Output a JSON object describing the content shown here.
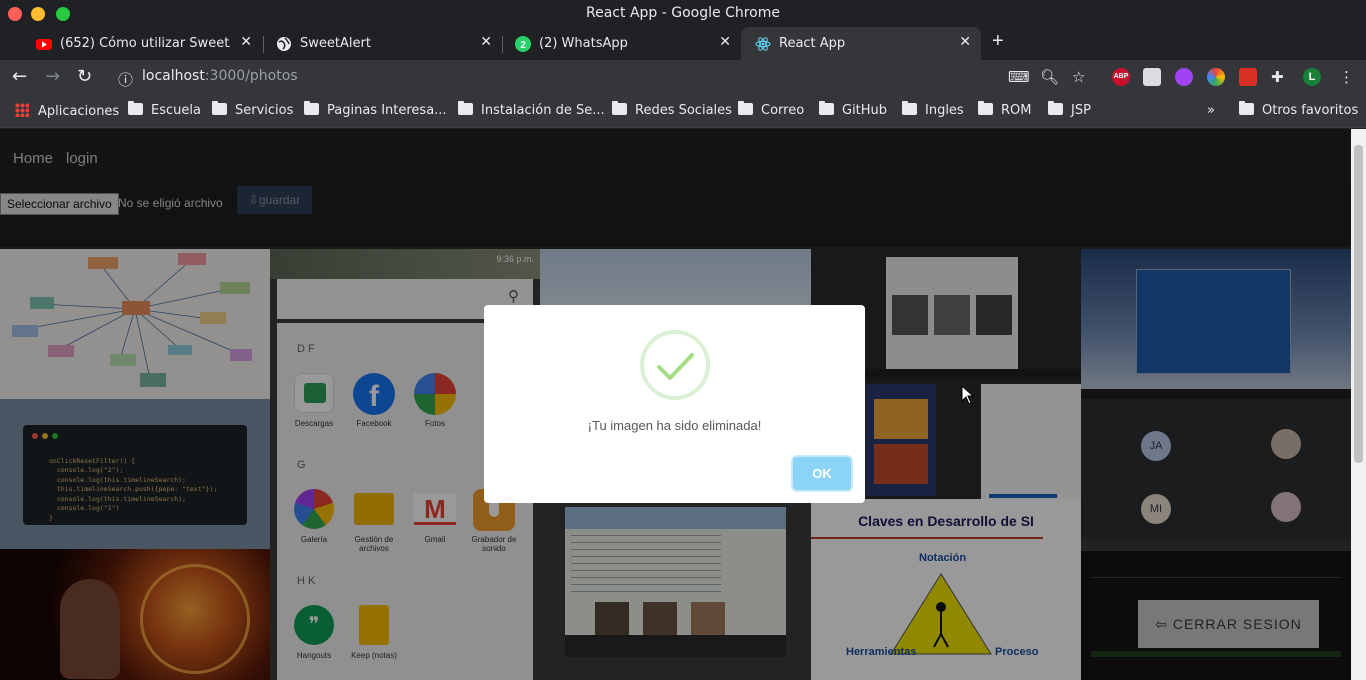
{
  "window": {
    "title": "React App - Google Chrome"
  },
  "tabs": [
    {
      "label": "(652) Cómo utilizar SweetAlert",
      "icon": "youtube-icon"
    },
    {
      "label": "SweetAlert",
      "icon": "globe-icon"
    },
    {
      "label": "(2) WhatsApp",
      "icon": "whatsapp-icon",
      "badge": "2"
    },
    {
      "label": "React App",
      "icon": "react-icon"
    }
  ],
  "toolbar": {
    "url_host": "localhost",
    "url_path": ":3000/photos",
    "profile_initial": "L",
    "abp_label": "ABP"
  },
  "bookmarks": {
    "apps": "Aplicaciones",
    "items": [
      "Escuela",
      "Servicios",
      "Paginas Interesa...",
      "Instalación de Se...",
      "Redes Sociales",
      "Correo",
      "GitHub",
      "Ingles",
      "ROM",
      "JSP"
    ],
    "overflow": "»",
    "other": "Otros favoritos"
  },
  "app": {
    "nav": {
      "home": "Home",
      "login": "login"
    },
    "upload": {
      "choose_file": "Seleccionar archivo",
      "no_file": "No se eligió archivo",
      "save": "guardar"
    },
    "logout": "CERRAR SESION"
  },
  "gallery": {
    "phone_time": "9:36 p.m.",
    "sections": [
      "D F",
      "G",
      "H K"
    ],
    "apps": [
      "Descargas",
      "Facebook",
      "Fotos",
      "Galería",
      "Gestión de archivos",
      "Gmail",
      "Grabador de sonido",
      "Hangouts",
      "Keep (notas)"
    ],
    "code_lines": [
      "onClickResetFilter() {",
      "  console.log(\"2\");",
      "  console.log(this.timelineSearch);",
      "  this.timelineSearch.push({pepe: \"text\"});",
      "  console.log(this.timelineSearch);",
      "  console.log(\"1\")",
      "}"
    ],
    "slide_title": "Claves en Desarrollo de SI",
    "slide_labels": [
      "Notación",
      "Herramientas",
      "Proceso"
    ],
    "call_initials": [
      "JA",
      "MI"
    ]
  },
  "dialog": {
    "message": "¡Tu imagen ha sido eliminada!",
    "ok": "OK"
  }
}
